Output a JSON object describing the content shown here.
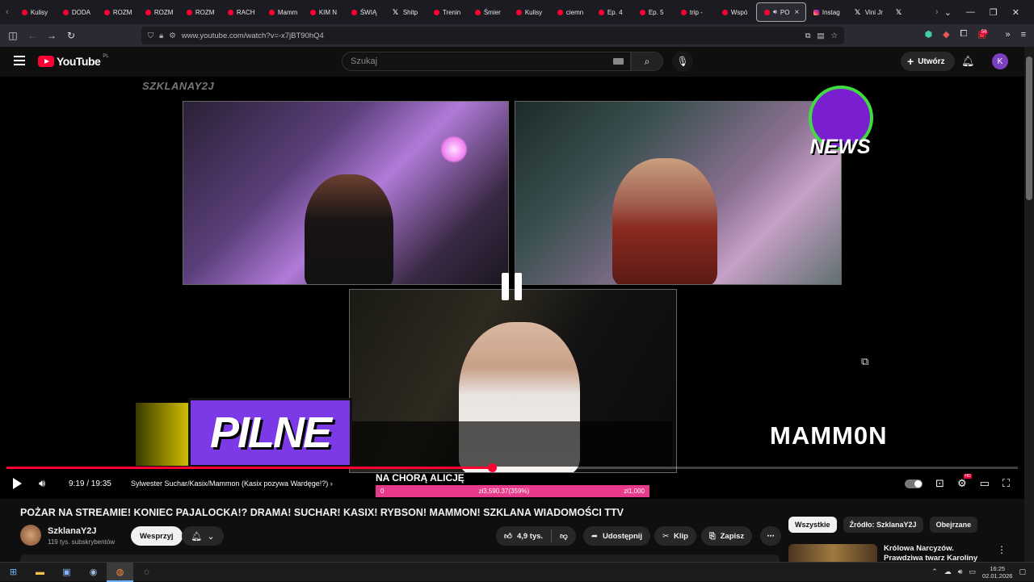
{
  "browser": {
    "tabs": [
      {
        "label": "Kulisy",
        "icon": "youtube-icon"
      },
      {
        "label": "DODA",
        "icon": "youtube-icon"
      },
      {
        "label": "ROZM",
        "icon": "youtube-icon"
      },
      {
        "label": "ROZM",
        "icon": "youtube-icon"
      },
      {
        "label": "ROZM",
        "icon": "youtube-icon"
      },
      {
        "label": "RACH",
        "icon": "youtube-icon"
      },
      {
        "label": "Mamm",
        "icon": "youtube-icon"
      },
      {
        "label": "KIM N",
        "icon": "youtube-icon"
      },
      {
        "label": "ŚWIĄ",
        "icon": "youtube-icon"
      },
      {
        "label": "Shitp",
        "icon": "x-icon"
      },
      {
        "label": "Trenin",
        "icon": "youtube-icon"
      },
      {
        "label": "Śmier",
        "icon": "youtube-icon"
      },
      {
        "label": "Kulisy",
        "icon": "youtube-icon"
      },
      {
        "label": "ciemn",
        "icon": "youtube-icon"
      },
      {
        "label": "Ep. 4",
        "icon": "youtube-icon"
      },
      {
        "label": "Ep. 5",
        "icon": "youtube-icon"
      },
      {
        "label": "trip - ",
        "icon": "youtube-icon"
      },
      {
        "label": "Wspó",
        "icon": "youtube-icon"
      },
      {
        "label": "PO",
        "icon": "youtube-icon",
        "active": true
      },
      {
        "label": "Instag",
        "icon": "instagram-icon"
      },
      {
        "label": "Vini Jr",
        "icon": "x-icon"
      },
      {
        "label": "",
        "icon": "x-icon"
      }
    ],
    "url": "www.youtube.com/watch?v=-x7jBT90hQ4",
    "extensions_badge": "56"
  },
  "youtube": {
    "logo_text": "YouTube",
    "country_code": "PL",
    "search_placeholder": "Szukaj",
    "create_label": "Utwórz",
    "avatar_letter": "K"
  },
  "video_overlay": {
    "watermark": "SZKLANAY2J",
    "news_logo": "NEWS",
    "pilne": "PILNE",
    "mammon": "MAMM0N",
    "ticker_title": "NA CHORĄ ALICJĘ",
    "goal_left": "0",
    "goal_mid": "zł3,590.37(359%)",
    "goal_right": "zł1,000"
  },
  "player": {
    "progress_fraction": 0.48,
    "time": "9:19 / 19:35",
    "chapter": "Sylwester Suchar/Kasix/Mammon (Kasix pozywa Wardęge!?)"
  },
  "video_info": {
    "title": "POŻAR NA STREAMIE! KONIEC PAJALOCKA!? DRAMA! SUCHAR! KASIX! RYBSON! MAMMON! SZKLANA WIADOMOŚCI TTV",
    "channel": "SzklanaY2J",
    "subscribers": "119 tys. subskrybentów",
    "support_label": "Wesprzyj",
    "likes": "4,9 tys.",
    "share_label": "Udostępnij",
    "clip_label": "Klip",
    "save_label": "Zapisz"
  },
  "sidebar": {
    "chips": [
      "Wszystkie",
      "Źródło: SzklanaY2J",
      "Obejrzane"
    ],
    "reco_title": "Królowa Narcyzów. Prawdziwa twarz Karoliny Pomaradzkiej"
  },
  "taskbar": {
    "time": "16:25",
    "date": "02.01.2026"
  },
  "colors": {
    "accent": "#ff0033",
    "pilne_bg": "#7c3ae6",
    "goal_bar": "#e83a8a"
  }
}
